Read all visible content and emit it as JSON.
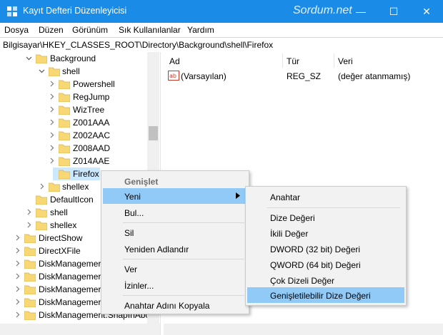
{
  "window": {
    "title": "Kayıt Defteri Düzenleyicisi",
    "watermark": "Sordum.net",
    "minimize_glyph": "—",
    "maximize_glyph": "☐",
    "close_glyph": "✕"
  },
  "menubar": [
    "Dosya",
    "Düzen",
    "Görünüm",
    "Sık Kullanılanlar",
    "Yardım"
  ],
  "address": "Bilgisayar\\HKEY_CLASSES_ROOT\\Directory\\Background\\shell\\Firefox",
  "tree": [
    {
      "label": "Background",
      "expanded": true
    },
    {
      "label": "shell",
      "expanded": true
    },
    {
      "label": "Powershell"
    },
    {
      "label": "RegJump"
    },
    {
      "label": "WizTree"
    },
    {
      "label": "Z001AAA"
    },
    {
      "label": "Z002AAC"
    },
    {
      "label": "Z008AAD"
    },
    {
      "label": "Z014AAE"
    },
    {
      "label": "Firefox",
      "selected": true
    },
    {
      "label": "shellex"
    },
    {
      "label": "DefaultIcon"
    },
    {
      "label": "shell"
    },
    {
      "label": "shellex"
    },
    {
      "label": "DirectShow"
    },
    {
      "label": "DirectXFile"
    },
    {
      "label": "DiskManagemer"
    },
    {
      "label": "DiskManagemer"
    },
    {
      "label": "DiskManagemer"
    },
    {
      "label": "DiskManagemer"
    },
    {
      "label": "DiskManagement.SnapInAbc"
    }
  ],
  "list": {
    "headers": [
      "Ad",
      "Tür",
      "Veri"
    ],
    "rows": [
      {
        "name": "(Varsayılan)",
        "type": "REG_SZ",
        "data": "(değer atanmamış)",
        "icon": "ab-string-icon"
      }
    ]
  },
  "context_menu": {
    "items": [
      "Genişlet",
      "Yeni",
      "Bul...",
      "Sil",
      "Yeniden Adlandır",
      "Ver",
      "İzinler...",
      "Anahtar Adını Kopyala"
    ],
    "highlighted": "Yeni"
  },
  "submenu": {
    "items": [
      "Anahtar",
      "Dize Değeri",
      "İkili Değer",
      "DWORD (32 bit) Değeri",
      "QWORD (64 bit) Değeri",
      "Çok Dizeli Değer",
      "Genişletilebilir Dize Değeri"
    ],
    "highlighted": "Genişletilebilir Dize Değeri"
  },
  "colors": {
    "titlebar": "#1a8ce8",
    "selection": "#cce8ff",
    "menu_highlight": "#91c9f7",
    "folder": "#f8d775"
  }
}
